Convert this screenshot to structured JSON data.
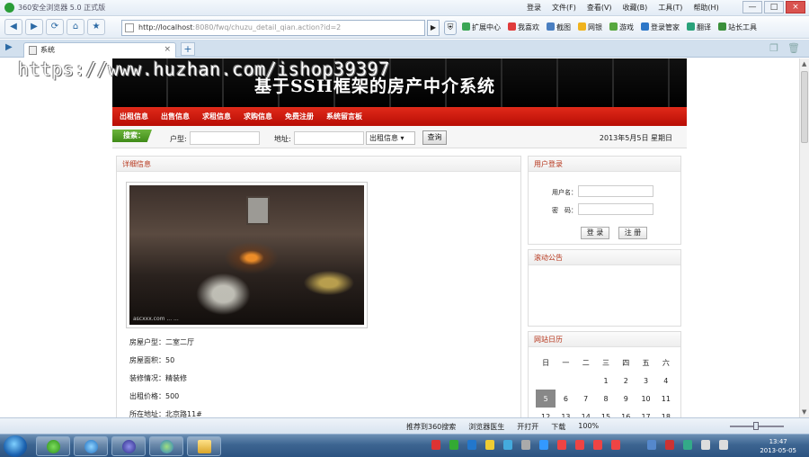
{
  "browser": {
    "title": "360安全浏览器 5.0 正式版",
    "menus": [
      "登录",
      "文件(F)",
      "查看(V)",
      "收藏(B)",
      "工具(T)",
      "帮助(H)"
    ],
    "window_controls": [
      "—",
      "□",
      "×"
    ],
    "address_host": "http://localhost",
    "address_rest": ":8080/fwq/chuzu_detail_qian.action?id=2",
    "tools": [
      "扩展中心",
      "我喜欢",
      "截图",
      "网银",
      "游戏",
      "登录管家",
      "翻译",
      "站长工具"
    ],
    "tab_title": "系统",
    "tab_close": "×",
    "new_tab": "+"
  },
  "watermark": "https://www.huzhan.com/ishop39397",
  "site": {
    "heading": "基于SSH框架的房产中介系统",
    "menu": [
      "出租信息",
      "出售信息",
      "求租信息",
      "求购信息",
      "免费注册",
      "系统留言板"
    ],
    "search": {
      "badge": "搜索：",
      "huxing_label": "户型:",
      "address_label": "地址:",
      "category": "出租信息 ▾",
      "button": "查询",
      "date": "2013年5月5日 星期日"
    }
  },
  "detail": {
    "header": "详细信息",
    "photo_caption": "ascxxx.com  ...  ...",
    "fields": [
      {
        "label": "房屋户型：",
        "value": "二室二厅"
      },
      {
        "label": "房屋面积：",
        "value": "50"
      },
      {
        "label": "装修情况：",
        "value": "精装修"
      },
      {
        "label": "出租价格：",
        "value": "500"
      },
      {
        "label": "所在地址：",
        "value": "北京路11#"
      }
    ]
  },
  "login": {
    "header": "用户登录",
    "username_label": "用户名：",
    "password_label": "密　码：",
    "login_button": "登 录",
    "register_button": "注 册"
  },
  "notice": {
    "header": "滚动公告"
  },
  "calendar": {
    "header": "网站日历",
    "weekdays": [
      "日",
      "一",
      "二",
      "三",
      "四",
      "五",
      "六"
    ],
    "rows": [
      [
        "",
        "",
        "",
        "1",
        "2",
        "3",
        "4"
      ],
      [
        "5",
        "6",
        "7",
        "8",
        "9",
        "10",
        "11"
      ],
      [
        "12",
        "13",
        "14",
        "15",
        "16",
        "17",
        "18"
      ]
    ],
    "today": "5"
  },
  "statusbar": {
    "items": [
      "推荐到360搜索",
      "浏览器医生",
      "开打开",
      "下载"
    ],
    "zoom": "100%"
  },
  "clock": {
    "time": "13:47",
    "date": "2013-05-05"
  }
}
